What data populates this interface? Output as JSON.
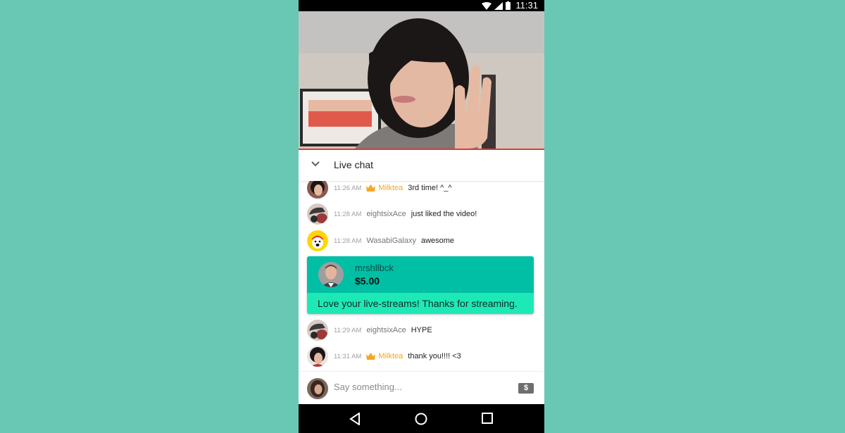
{
  "status_bar": {
    "time": "11:31",
    "icons": [
      "wifi-icon",
      "signal-icon",
      "battery-icon"
    ]
  },
  "video": {
    "description": "Live stream video of streamer holding up three fingers",
    "progress_color": "#e53935"
  },
  "chat_header": {
    "title": "Live chat",
    "collapse_icon": "chevron-down-icon"
  },
  "messages": [
    {
      "time": "11:26 AM",
      "author": "Milktea",
      "owner": true,
      "text": "3rd time! ^_^"
    },
    {
      "time": "11:28 AM",
      "author": "eightsixAce",
      "owner": false,
      "text": "just liked the video!"
    },
    {
      "time": "11:28 AM",
      "author": "WasabiGalaxy",
      "owner": false,
      "text": "awesome"
    },
    {
      "time": "11:29 AM",
      "author": "eightsixAce",
      "owner": false,
      "text": "HYPE"
    },
    {
      "time": "11:31 AM",
      "author": "Milktea",
      "owner": true,
      "text": "thank you!!!! <3"
    }
  ],
  "super_chat": {
    "author": "mrshllbck",
    "amount": "$5.00",
    "message": "Love your live-streams! Thanks for streaming.",
    "header_color": "#00bfa5",
    "body_color": "#1de9b6"
  },
  "composer": {
    "placeholder": "Say something...",
    "value": "",
    "dollar_label": "$"
  },
  "colors": {
    "background": "#68c8b4",
    "owner_name": "#f5a623"
  }
}
